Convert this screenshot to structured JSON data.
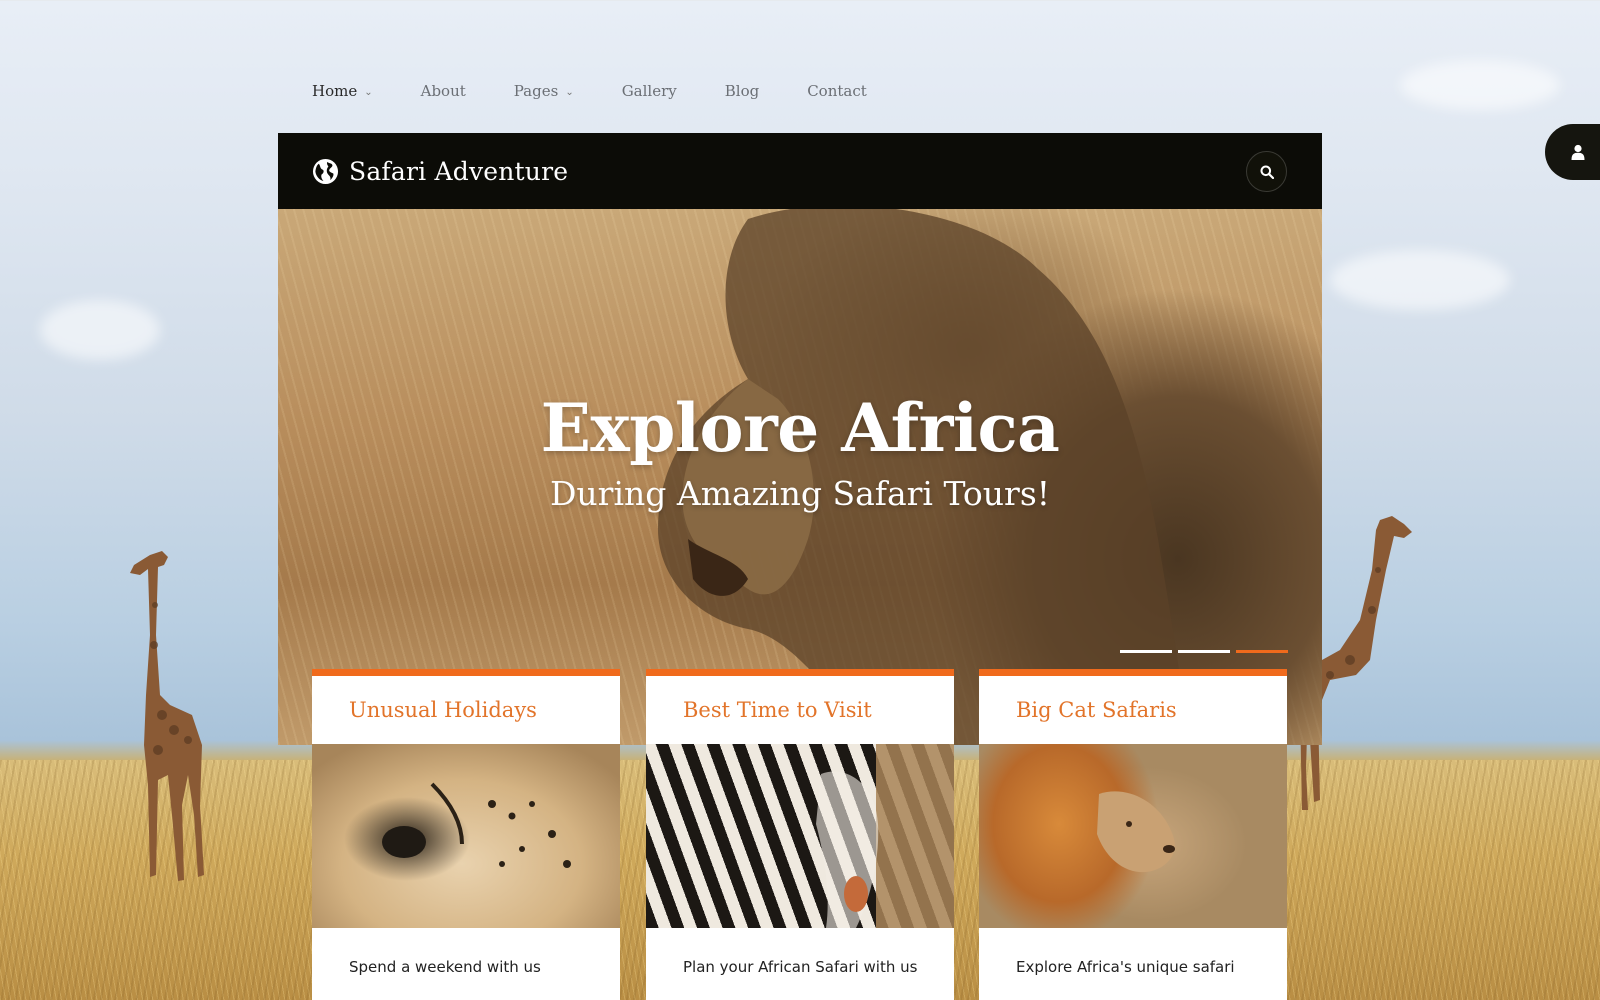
{
  "nav": {
    "items": [
      {
        "label": "Home",
        "has_dropdown": true,
        "active": true
      },
      {
        "label": "About",
        "has_dropdown": false,
        "active": false
      },
      {
        "label": "Pages",
        "has_dropdown": true,
        "active": false
      },
      {
        "label": "Gallery",
        "has_dropdown": false,
        "active": false
      },
      {
        "label": "Blog",
        "has_dropdown": false,
        "active": false
      },
      {
        "label": "Contact",
        "has_dropdown": false,
        "active": false
      }
    ]
  },
  "header": {
    "site_title": "Safari Adventure",
    "logo_icon": "globe-icon",
    "search_icon": "search-icon",
    "user_icon": "user-icon",
    "background_color": "#0c0c07"
  },
  "hero": {
    "title": "Explore Africa",
    "subtitle": "During Amazing Safari Tours!",
    "slides": [
      {
        "active": false
      },
      {
        "active": false
      },
      {
        "active": true
      }
    ]
  },
  "cards": [
    {
      "title": "Unusual Holidays",
      "image": "cheetah",
      "text": "Spend a weekend with us"
    },
    {
      "title": "Best Time to Visit",
      "image": "zebra",
      "text": "Plan your African Safari with us"
    },
    {
      "title": "Big Cat Safaris",
      "image": "lion",
      "text": "Explore Africa's unique safari"
    }
  ],
  "colors": {
    "accent": "#f06a1c",
    "card_title": "#e2742a",
    "text_dark": "#222222",
    "nav_text": "#6b6f75"
  }
}
